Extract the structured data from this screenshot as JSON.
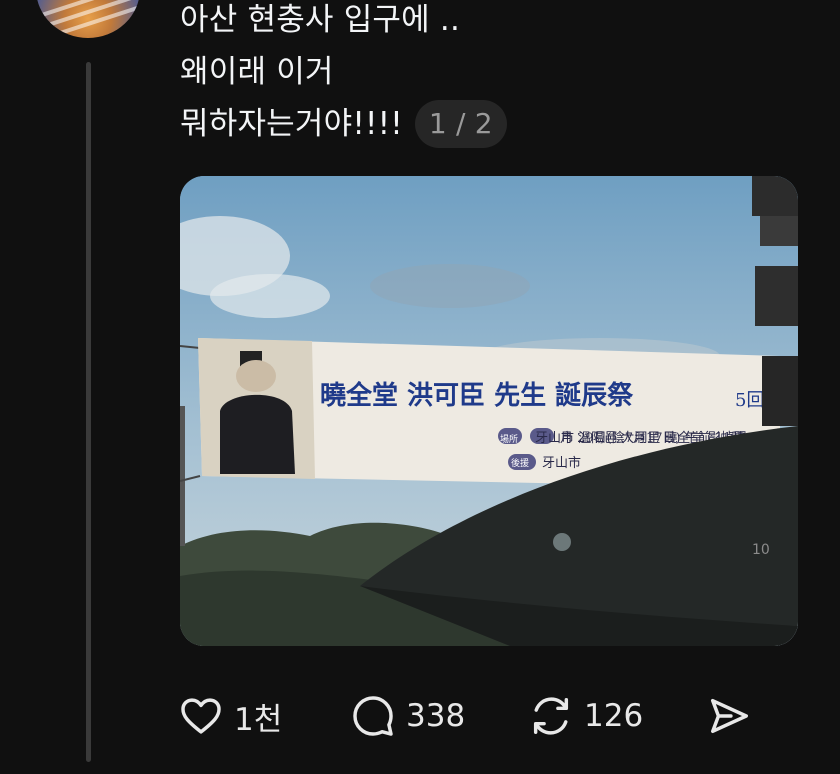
{
  "post": {
    "lines": [
      "아산 현충사  입구에 ..",
      "왜이래 이거",
      "뭐하자는거야!!!!"
    ],
    "page_indicator": "1 / 2"
  },
  "banner": {
    "title": "曉全堂 洪可臣 先生 誕辰祭",
    "side_text": "5回",
    "date_line": "月 29日(陰7月17日) 午前 11時",
    "place_tag": "場所",
    "place": "牙山市 溫陽邑 大洞里 曉全堂 影幀閣",
    "host_tag": "後援",
    "host": "牙山市",
    "umbrella_mark": "10"
  },
  "actions": {
    "like_count": "1천",
    "reply_count": "338",
    "repost_count": "126"
  },
  "icons": {
    "like": "heart-icon",
    "reply": "comment-bubble-icon",
    "repost": "repost-arrows-icon",
    "share": "send-icon"
  }
}
